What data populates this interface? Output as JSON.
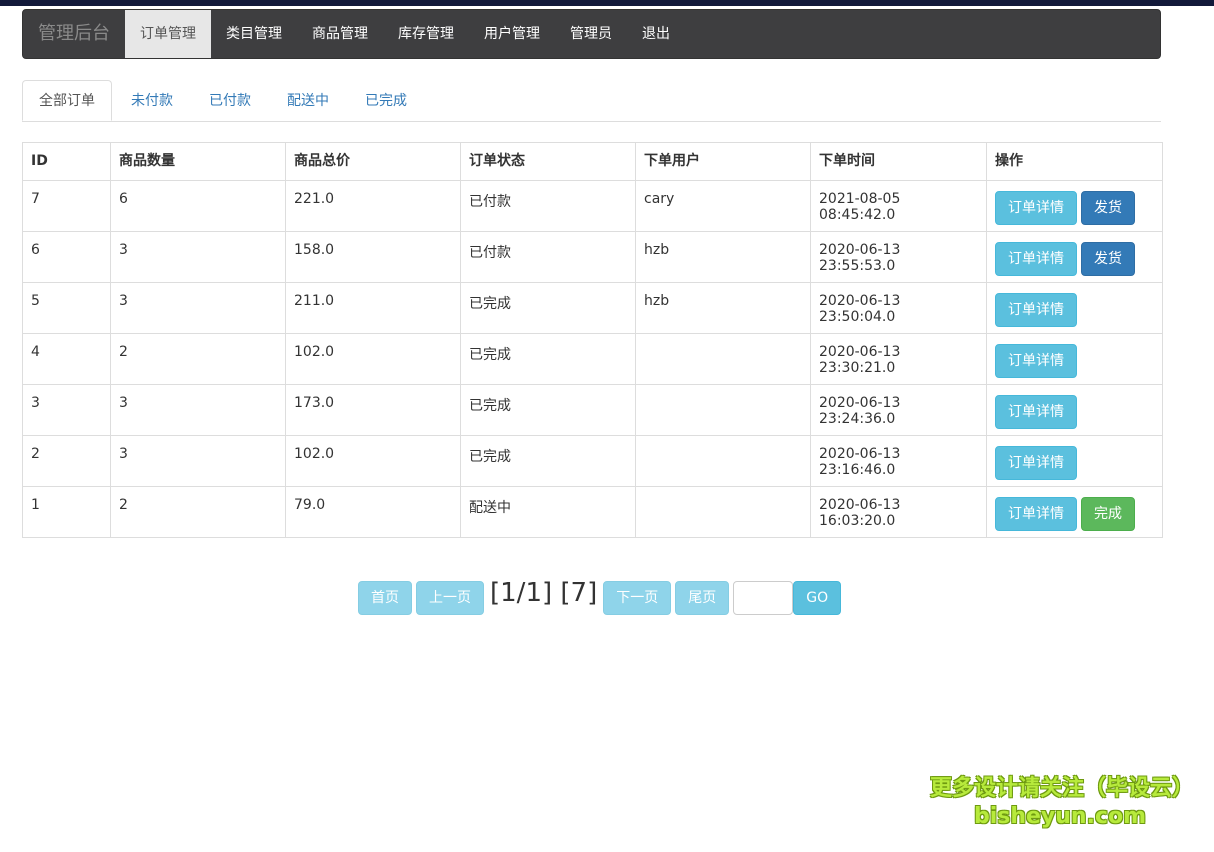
{
  "navbar": {
    "brand": "管理后台",
    "items": [
      {
        "label": "订单管理",
        "active": true
      },
      {
        "label": "类目管理",
        "active": false
      },
      {
        "label": "商品管理",
        "active": false
      },
      {
        "label": "库存管理",
        "active": false
      },
      {
        "label": "用户管理",
        "active": false
      },
      {
        "label": "管理员",
        "active": false
      },
      {
        "label": "退出",
        "active": false
      }
    ]
  },
  "tabs": [
    {
      "label": "全部订单",
      "active": true
    },
    {
      "label": "未付款",
      "active": false
    },
    {
      "label": "已付款",
      "active": false
    },
    {
      "label": "配送中",
      "active": false
    },
    {
      "label": "已完成",
      "active": false
    }
  ],
  "table": {
    "headers": [
      "ID",
      "商品数量",
      "商品总价",
      "订单状态",
      "下单用户",
      "下单时间",
      "操作"
    ],
    "rows": [
      {
        "id": "7",
        "qty": "6",
        "total": "221.0",
        "status": "已付款",
        "user": "cary",
        "time": "2021-08-05 08:45:42.0",
        "detail": "订单详情",
        "action": "发货",
        "action_type": "primary"
      },
      {
        "id": "6",
        "qty": "3",
        "total": "158.0",
        "status": "已付款",
        "user": "hzb",
        "time": "2020-06-13 23:55:53.0",
        "detail": "订单详情",
        "action": "发货",
        "action_type": "primary"
      },
      {
        "id": "5",
        "qty": "3",
        "total": "211.0",
        "status": "已完成",
        "user": "hzb",
        "time": "2020-06-13 23:50:04.0",
        "detail": "订单详情",
        "action": "",
        "action_type": ""
      },
      {
        "id": "4",
        "qty": "2",
        "total": "102.0",
        "status": "已完成",
        "user": "",
        "time": "2020-06-13 23:30:21.0",
        "detail": "订单详情",
        "action": "",
        "action_type": ""
      },
      {
        "id": "3",
        "qty": "3",
        "total": "173.0",
        "status": "已完成",
        "user": "",
        "time": "2020-06-13 23:24:36.0",
        "detail": "订单详情",
        "action": "",
        "action_type": ""
      },
      {
        "id": "2",
        "qty": "3",
        "total": "102.0",
        "status": "已完成",
        "user": "",
        "time": "2020-06-13 23:16:46.0",
        "detail": "订单详情",
        "action": "",
        "action_type": ""
      },
      {
        "id": "1",
        "qty": "2",
        "total": "79.0",
        "status": "配送中",
        "user": "",
        "time": "2020-06-13 16:03:20.0",
        "detail": "订单详情",
        "action": "完成",
        "action_type": "success"
      }
    ]
  },
  "pager": {
    "first": "首页",
    "prev": "上一页",
    "info": "[1/1] [7]",
    "next": "下一页",
    "last": "尾页",
    "input_value": "",
    "go": "GO"
  },
  "watermark": {
    "line1": "更多设计请关注（毕设云）",
    "line2": "bisheyun.com"
  },
  "colors": {
    "navbar_bg": "#3e3e40",
    "info_button": "#5bc0de",
    "primary_button": "#337ab7",
    "success_button": "#5cb85c",
    "link": "#337ab7"
  }
}
